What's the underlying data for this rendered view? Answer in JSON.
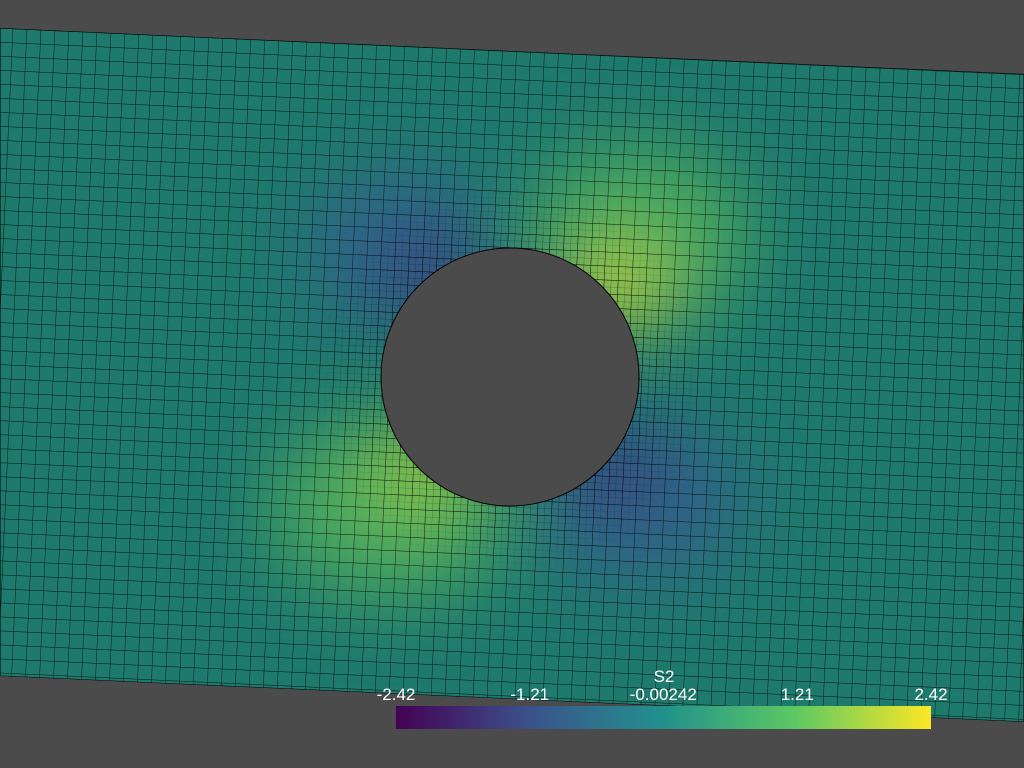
{
  "legend": {
    "title": "S2",
    "min": -2.42,
    "max": 2.42,
    "ticks": [
      {
        "value": -2.42,
        "label": "-2.42"
      },
      {
        "value": -1.21,
        "label": "-1.21"
      },
      {
        "value": -0.00242,
        "label": "-0.00242"
      },
      {
        "value": 1.21,
        "label": "1.21"
      },
      {
        "value": 2.42,
        "label": "2.42"
      }
    ],
    "colormap": [
      "#440154",
      "#3b528b",
      "#21918c",
      "#5ec962",
      "#fde725"
    ]
  },
  "colors": {
    "background": "#4b4b4b",
    "mesh_edge": "#000000",
    "label_text": "#ffffff"
  }
}
